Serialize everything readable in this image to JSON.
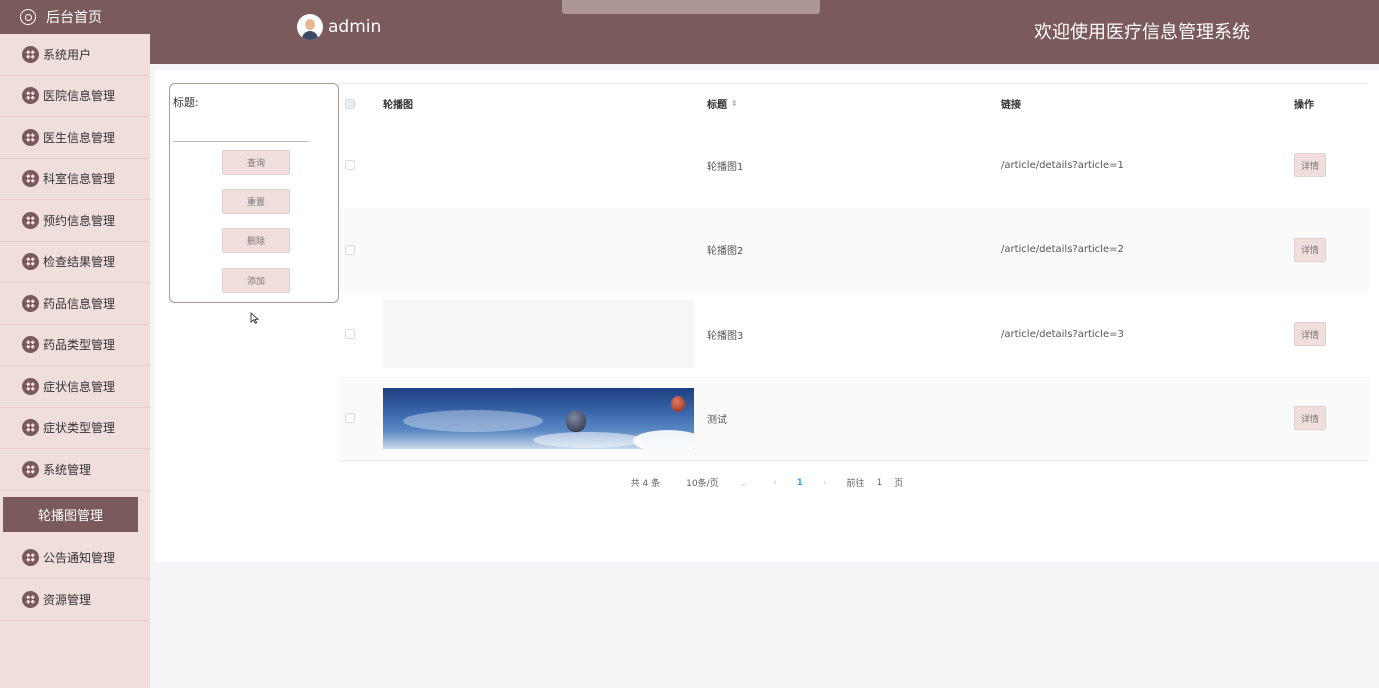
{
  "sidebar": {
    "home": "后台首页",
    "items": [
      {
        "label": "系统用户"
      },
      {
        "label": "医院信息管理"
      },
      {
        "label": "医生信息管理"
      },
      {
        "label": "科室信息管理"
      },
      {
        "label": "预约信息管理"
      },
      {
        "label": "检查结果管理"
      },
      {
        "label": "药品信息管理"
      },
      {
        "label": "药品类型管理"
      },
      {
        "label": "症状信息管理"
      },
      {
        "label": "症状类型管理"
      },
      {
        "label": "系统管理"
      },
      {
        "label": "轮播图管理",
        "active": true
      },
      {
        "label": "公告通知管理"
      },
      {
        "label": "资源管理"
      }
    ]
  },
  "header": {
    "username": "admin",
    "welcome": "欢迎使用医疗信息管理系统"
  },
  "search": {
    "label": "标题:",
    "value": "",
    "buttons": {
      "query": "查询",
      "reset": "重置",
      "delete": "删除",
      "add": "添加"
    }
  },
  "table": {
    "headers": {
      "image": "轮播图",
      "title": "标题",
      "link": "链接",
      "action": "操作"
    },
    "sort_icon": "sort-caret-icon",
    "rows": [
      {
        "image": "none",
        "title": "轮播图1",
        "link": "/article/details?article=1",
        "action": "详情"
      },
      {
        "image": "none",
        "title": "轮播图2",
        "link": "/article/details?article=2",
        "action": "详情"
      },
      {
        "image": "placeholder",
        "title": "轮播图3",
        "link": "/article/details?article=3",
        "action": "详情"
      },
      {
        "image": "balloon-photo",
        "title": "测试",
        "link": "",
        "action": "详情"
      }
    ]
  },
  "pagination": {
    "total": "共 4 条",
    "page_size": "10条/页",
    "prev": "‹",
    "current": "1",
    "next": "›",
    "goto_prefix": "前往",
    "goto_value": "1",
    "goto_suffix": "页"
  },
  "colors": {
    "brand": "#7a5a5a",
    "sidebar_bg": "#f0dedc",
    "link_active": "#409eff"
  }
}
